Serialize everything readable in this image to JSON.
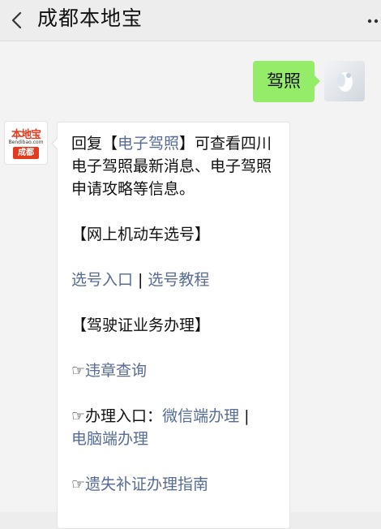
{
  "header": {
    "title": "成都本地宝"
  },
  "my_message": {
    "text": "驾照"
  },
  "bot_avatar": {
    "logo_text": "本地宝",
    "logo_url": "Bendibao.com",
    "city": "成都"
  },
  "reply": {
    "intro_prefix": "回复【",
    "intro_keyword": "电子驾照",
    "intro_suffix": "】可查看四川电子驾照最新消息、电子驾照申请攻略等信息。",
    "section1_title": "【网上机动车选号】",
    "link_select_entry": "选号入口",
    "separator": "|",
    "link_select_tutorial": "选号教程",
    "section2_title": "【驾驶证业务办理】",
    "pointer": "☞",
    "link_violation": "违章查询",
    "entry_label": "办理入口：",
    "link_wechat": "微信端办理",
    "link_pc": "电脑端办理",
    "link_lost": "遗失补证办理指南"
  }
}
